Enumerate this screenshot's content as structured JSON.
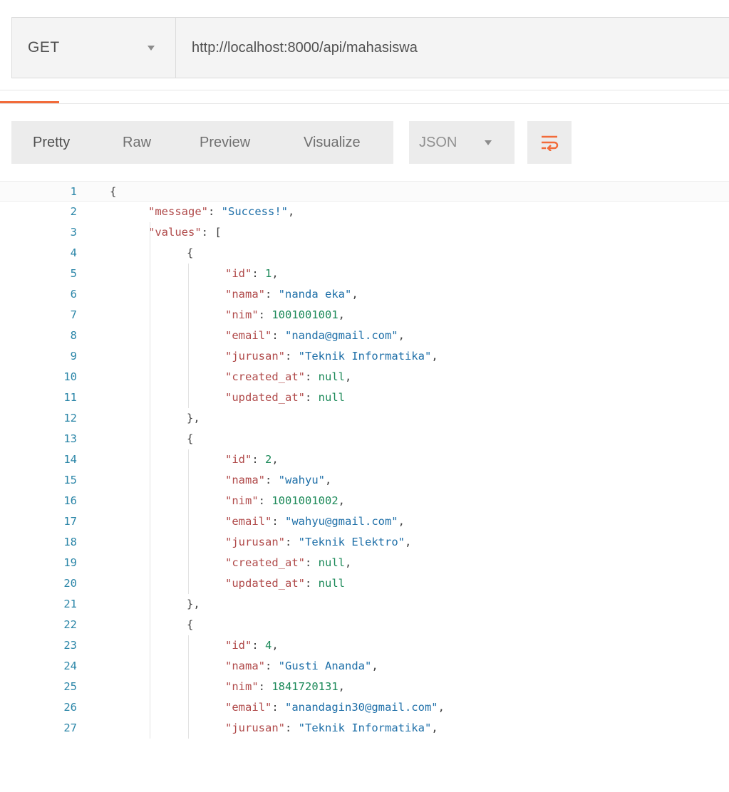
{
  "request": {
    "method": "GET",
    "url": "http://localhost:8000/api/mahasiswa"
  },
  "response_toolbar": {
    "view_tabs": [
      "Pretty",
      "Raw",
      "Preview",
      "Visualize"
    ],
    "format": "JSON",
    "wrap_icon": "wrap-lines-icon",
    "accent_color": "#f26b3a"
  },
  "response_body": {
    "line_numbers": [
      "1",
      "2",
      "3",
      "4",
      "5",
      "6",
      "7",
      "8",
      "9",
      "10",
      "11",
      "12",
      "13",
      "14",
      "15",
      "16",
      "17",
      "18",
      "19",
      "20",
      "21",
      "22",
      "23",
      "24",
      "25",
      "26",
      "27"
    ],
    "lines": [
      [
        {
          "t": "p",
          "v": "{"
        }
      ],
      [
        {
          "t": "k",
          "v": "\"message\""
        },
        {
          "t": "p",
          "v": ": "
        },
        {
          "t": "s",
          "v": "\"Success!\""
        },
        {
          "t": "p",
          "v": ","
        }
      ],
      [
        {
          "t": "k",
          "v": "\"values\""
        },
        {
          "t": "p",
          "v": ": ["
        }
      ],
      [
        {
          "t": "p",
          "v": "{"
        }
      ],
      [
        {
          "t": "k",
          "v": "\"id\""
        },
        {
          "t": "p",
          "v": ": "
        },
        {
          "t": "n",
          "v": "1"
        },
        {
          "t": "p",
          "v": ","
        }
      ],
      [
        {
          "t": "k",
          "v": "\"nama\""
        },
        {
          "t": "p",
          "v": ": "
        },
        {
          "t": "s",
          "v": "\"nanda eka\""
        },
        {
          "t": "p",
          "v": ","
        }
      ],
      [
        {
          "t": "k",
          "v": "\"nim\""
        },
        {
          "t": "p",
          "v": ": "
        },
        {
          "t": "n",
          "v": "1001001001"
        },
        {
          "t": "p",
          "v": ","
        }
      ],
      [
        {
          "t": "k",
          "v": "\"email\""
        },
        {
          "t": "p",
          "v": ": "
        },
        {
          "t": "s",
          "v": "\"nanda@gmail.com\""
        },
        {
          "t": "p",
          "v": ","
        }
      ],
      [
        {
          "t": "k",
          "v": "\"jurusan\""
        },
        {
          "t": "p",
          "v": ": "
        },
        {
          "t": "s",
          "v": "\"Teknik Informatika\""
        },
        {
          "t": "p",
          "v": ","
        }
      ],
      [
        {
          "t": "k",
          "v": "\"created_at\""
        },
        {
          "t": "p",
          "v": ": "
        },
        {
          "t": "nl",
          "v": "null"
        },
        {
          "t": "p",
          "v": ","
        }
      ],
      [
        {
          "t": "k",
          "v": "\"updated_at\""
        },
        {
          "t": "p",
          "v": ": "
        },
        {
          "t": "nl",
          "v": "null"
        }
      ],
      [
        {
          "t": "p",
          "v": "},"
        }
      ],
      [
        {
          "t": "p",
          "v": "{"
        }
      ],
      [
        {
          "t": "k",
          "v": "\"id\""
        },
        {
          "t": "p",
          "v": ": "
        },
        {
          "t": "n",
          "v": "2"
        },
        {
          "t": "p",
          "v": ","
        }
      ],
      [
        {
          "t": "k",
          "v": "\"nama\""
        },
        {
          "t": "p",
          "v": ": "
        },
        {
          "t": "s",
          "v": "\"wahyu\""
        },
        {
          "t": "p",
          "v": ","
        }
      ],
      [
        {
          "t": "k",
          "v": "\"nim\""
        },
        {
          "t": "p",
          "v": ": "
        },
        {
          "t": "n",
          "v": "1001001002"
        },
        {
          "t": "p",
          "v": ","
        }
      ],
      [
        {
          "t": "k",
          "v": "\"email\""
        },
        {
          "t": "p",
          "v": ": "
        },
        {
          "t": "s",
          "v": "\"wahyu@gmail.com\""
        },
        {
          "t": "p",
          "v": ","
        }
      ],
      [
        {
          "t": "k",
          "v": "\"jurusan\""
        },
        {
          "t": "p",
          "v": ": "
        },
        {
          "t": "s",
          "v": "\"Teknik Elektro\""
        },
        {
          "t": "p",
          "v": ","
        }
      ],
      [
        {
          "t": "k",
          "v": "\"created_at\""
        },
        {
          "t": "p",
          "v": ": "
        },
        {
          "t": "nl",
          "v": "null"
        },
        {
          "t": "p",
          "v": ","
        }
      ],
      [
        {
          "t": "k",
          "v": "\"updated_at\""
        },
        {
          "t": "p",
          "v": ": "
        },
        {
          "t": "nl",
          "v": "null"
        }
      ],
      [
        {
          "t": "p",
          "v": "},"
        }
      ],
      [
        {
          "t": "p",
          "v": "{"
        }
      ],
      [
        {
          "t": "k",
          "v": "\"id\""
        },
        {
          "t": "p",
          "v": ": "
        },
        {
          "t": "n",
          "v": "4"
        },
        {
          "t": "p",
          "v": ","
        }
      ],
      [
        {
          "t": "k",
          "v": "\"nama\""
        },
        {
          "t": "p",
          "v": ": "
        },
        {
          "t": "s",
          "v": "\"Gusti Ananda\""
        },
        {
          "t": "p",
          "v": ","
        }
      ],
      [
        {
          "t": "k",
          "v": "\"nim\""
        },
        {
          "t": "p",
          "v": ": "
        },
        {
          "t": "n",
          "v": "1841720131"
        },
        {
          "t": "p",
          "v": ","
        }
      ],
      [
        {
          "t": "k",
          "v": "\"email\""
        },
        {
          "t": "p",
          "v": ": "
        },
        {
          "t": "s",
          "v": "\"anandagin30@gmail.com\""
        },
        {
          "t": "p",
          "v": ","
        }
      ],
      [
        {
          "t": "k",
          "v": "\"jurusan\""
        },
        {
          "t": "p",
          "v": ": "
        },
        {
          "t": "s",
          "v": "\"Teknik Informatika\""
        },
        {
          "t": "p",
          "v": ","
        }
      ]
    ],
    "indent_levels": [
      0,
      1,
      1,
      2,
      3,
      3,
      3,
      3,
      3,
      3,
      3,
      2,
      2,
      3,
      3,
      3,
      3,
      3,
      3,
      3,
      2,
      2,
      3,
      3,
      3,
      3,
      3
    ]
  }
}
